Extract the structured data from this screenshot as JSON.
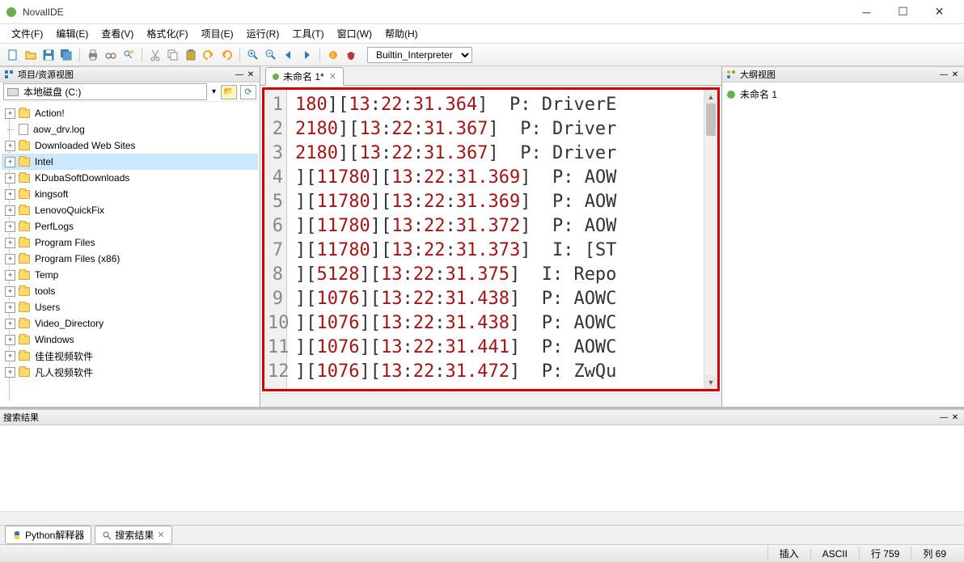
{
  "window": {
    "title": "NovalIDE"
  },
  "menu": {
    "file": "文件(F)",
    "edit": "编辑(E)",
    "view": "查看(V)",
    "format": "格式化(F)",
    "project": "项目(E)",
    "run": "运行(R)",
    "tools": "工具(T)",
    "window": "窗口(W)",
    "help": "帮助(H)"
  },
  "toolbar": {
    "interpreter": "Builtin_Interpreter"
  },
  "project_panel": {
    "title": "项目/资源视图",
    "path_label": "本地磁盘 (C:)",
    "items": [
      {
        "name": "Action!",
        "type": "folder",
        "expandable": true
      },
      {
        "name": "aow_drv.log",
        "type": "file",
        "expandable": false
      },
      {
        "name": "Downloaded Web Sites",
        "type": "folder",
        "expandable": true
      },
      {
        "name": "Intel",
        "type": "folder",
        "expandable": true,
        "selected": true
      },
      {
        "name": "KDubaSoftDownloads",
        "type": "folder",
        "expandable": true
      },
      {
        "name": "kingsoft",
        "type": "folder",
        "expandable": true
      },
      {
        "name": "LenovoQuickFix",
        "type": "folder",
        "expandable": true
      },
      {
        "name": "PerfLogs",
        "type": "folder",
        "expandable": true
      },
      {
        "name": "Program Files",
        "type": "folder",
        "expandable": true
      },
      {
        "name": "Program Files (x86)",
        "type": "folder",
        "expandable": true
      },
      {
        "name": "Temp",
        "type": "folder",
        "expandable": true
      },
      {
        "name": "tools",
        "type": "folder",
        "expandable": true
      },
      {
        "name": "Users",
        "type": "folder",
        "expandable": true
      },
      {
        "name": "Video_Directory",
        "type": "folder",
        "expandable": true
      },
      {
        "name": "Windows",
        "type": "folder",
        "expandable": true
      },
      {
        "name": "佳佳视频软件",
        "type": "folder",
        "expandable": true
      },
      {
        "name": "凡人视频软件",
        "type": "folder",
        "expandable": true
      }
    ]
  },
  "editor": {
    "tab_title": "未命名 1*",
    "lines": [
      {
        "n": "1",
        "segs": [
          {
            "t": "num",
            "v": "180"
          },
          {
            "t": "br",
            "v": "]["
          },
          {
            "t": "num",
            "v": "13"
          },
          {
            "t": "br",
            "v": ":"
          },
          {
            "t": "num",
            "v": "22"
          },
          {
            "t": "br",
            "v": ":"
          },
          {
            "t": "num",
            "v": "31.364"
          },
          {
            "t": "br",
            "v": "]"
          },
          {
            "t": "txt",
            "v": "  P: DriverE"
          }
        ]
      },
      {
        "n": "2",
        "segs": [
          {
            "t": "num",
            "v": "2180"
          },
          {
            "t": "br",
            "v": "]["
          },
          {
            "t": "num",
            "v": "13"
          },
          {
            "t": "br",
            "v": ":"
          },
          {
            "t": "num",
            "v": "22"
          },
          {
            "t": "br",
            "v": ":"
          },
          {
            "t": "num",
            "v": "31.367"
          },
          {
            "t": "br",
            "v": "]"
          },
          {
            "t": "txt",
            "v": "  P: Driver"
          }
        ]
      },
      {
        "n": "3",
        "segs": [
          {
            "t": "num",
            "v": "2180"
          },
          {
            "t": "br",
            "v": "]["
          },
          {
            "t": "num",
            "v": "13"
          },
          {
            "t": "br",
            "v": ":"
          },
          {
            "t": "num",
            "v": "22"
          },
          {
            "t": "br",
            "v": ":"
          },
          {
            "t": "num",
            "v": "31.367"
          },
          {
            "t": "br",
            "v": "]"
          },
          {
            "t": "txt",
            "v": "  P: Driver"
          }
        ]
      },
      {
        "n": "4",
        "segs": [
          {
            "t": "br",
            "v": "]["
          },
          {
            "t": "num",
            "v": "11780"
          },
          {
            "t": "br",
            "v": "]["
          },
          {
            "t": "num",
            "v": "13"
          },
          {
            "t": "br",
            "v": ":"
          },
          {
            "t": "num",
            "v": "22"
          },
          {
            "t": "br",
            "v": ":"
          },
          {
            "t": "num",
            "v": "31.369"
          },
          {
            "t": "br",
            "v": "]"
          },
          {
            "t": "txt",
            "v": "  P: AOW"
          }
        ]
      },
      {
        "n": "5",
        "segs": [
          {
            "t": "br",
            "v": "]["
          },
          {
            "t": "num",
            "v": "11780"
          },
          {
            "t": "br",
            "v": "]["
          },
          {
            "t": "num",
            "v": "13"
          },
          {
            "t": "br",
            "v": ":"
          },
          {
            "t": "num",
            "v": "22"
          },
          {
            "t": "br",
            "v": ":"
          },
          {
            "t": "num",
            "v": "31.369"
          },
          {
            "t": "br",
            "v": "]"
          },
          {
            "t": "txt",
            "v": "  P: AOW"
          }
        ]
      },
      {
        "n": "6",
        "segs": [
          {
            "t": "br",
            "v": "]["
          },
          {
            "t": "num",
            "v": "11780"
          },
          {
            "t": "br",
            "v": "]["
          },
          {
            "t": "num",
            "v": "13"
          },
          {
            "t": "br",
            "v": ":"
          },
          {
            "t": "num",
            "v": "22"
          },
          {
            "t": "br",
            "v": ":"
          },
          {
            "t": "num",
            "v": "31.372"
          },
          {
            "t": "br",
            "v": "]"
          },
          {
            "t": "txt",
            "v": "  P: AOW"
          }
        ]
      },
      {
        "n": "7",
        "segs": [
          {
            "t": "br",
            "v": "]["
          },
          {
            "t": "num",
            "v": "11780"
          },
          {
            "t": "br",
            "v": "]["
          },
          {
            "t": "num",
            "v": "13"
          },
          {
            "t": "br",
            "v": ":"
          },
          {
            "t": "num",
            "v": "22"
          },
          {
            "t": "br",
            "v": ":"
          },
          {
            "t": "num",
            "v": "31.373"
          },
          {
            "t": "br",
            "v": "]"
          },
          {
            "t": "txt",
            "v": "  I: [ST"
          }
        ]
      },
      {
        "n": "8",
        "segs": [
          {
            "t": "br",
            "v": "]["
          },
          {
            "t": "num",
            "v": "5128"
          },
          {
            "t": "br",
            "v": "]["
          },
          {
            "t": "num",
            "v": "13"
          },
          {
            "t": "br",
            "v": ":"
          },
          {
            "t": "num",
            "v": "22"
          },
          {
            "t": "br",
            "v": ":"
          },
          {
            "t": "num",
            "v": "31.375"
          },
          {
            "t": "br",
            "v": "]"
          },
          {
            "t": "txt",
            "v": "  I: Repo"
          }
        ]
      },
      {
        "n": "9",
        "segs": [
          {
            "t": "br",
            "v": "]["
          },
          {
            "t": "num",
            "v": "1076"
          },
          {
            "t": "br",
            "v": "]["
          },
          {
            "t": "num",
            "v": "13"
          },
          {
            "t": "br",
            "v": ":"
          },
          {
            "t": "num",
            "v": "22"
          },
          {
            "t": "br",
            "v": ":"
          },
          {
            "t": "num",
            "v": "31.438"
          },
          {
            "t": "br",
            "v": "]"
          },
          {
            "t": "txt",
            "v": "  P: AOWC"
          }
        ]
      },
      {
        "n": "10",
        "segs": [
          {
            "t": "br",
            "v": "]["
          },
          {
            "t": "num",
            "v": "1076"
          },
          {
            "t": "br",
            "v": "]["
          },
          {
            "t": "num",
            "v": "13"
          },
          {
            "t": "br",
            "v": ":"
          },
          {
            "t": "num",
            "v": "22"
          },
          {
            "t": "br",
            "v": ":"
          },
          {
            "t": "num",
            "v": "31.438"
          },
          {
            "t": "br",
            "v": "]"
          },
          {
            "t": "txt",
            "v": "  P: AOWC"
          }
        ]
      },
      {
        "n": "11",
        "segs": [
          {
            "t": "br",
            "v": "]["
          },
          {
            "t": "num",
            "v": "1076"
          },
          {
            "t": "br",
            "v": "]["
          },
          {
            "t": "num",
            "v": "13"
          },
          {
            "t": "br",
            "v": ":"
          },
          {
            "t": "num",
            "v": "22"
          },
          {
            "t": "br",
            "v": ":"
          },
          {
            "t": "num",
            "v": "31.441"
          },
          {
            "t": "br",
            "v": "]"
          },
          {
            "t": "txt",
            "v": "  P: AOWC"
          }
        ]
      },
      {
        "n": "12",
        "segs": [
          {
            "t": "br",
            "v": "]["
          },
          {
            "t": "num",
            "v": "1076"
          },
          {
            "t": "br",
            "v": "]["
          },
          {
            "t": "num",
            "v": "13"
          },
          {
            "t": "br",
            "v": ":"
          },
          {
            "t": "num",
            "v": "22"
          },
          {
            "t": "br",
            "v": ":"
          },
          {
            "t": "num",
            "v": "31.472"
          },
          {
            "t": "br",
            "v": "]"
          },
          {
            "t": "txt",
            "v": "  P: ZwQu"
          }
        ]
      }
    ]
  },
  "outline": {
    "title": "大纲视图",
    "item": "未命名 1"
  },
  "search": {
    "title": "搜索结果"
  },
  "bottom_tabs": {
    "python": "Python解释器",
    "search": "搜索结果"
  },
  "status": {
    "mode": "插入",
    "encoding": "ASCII",
    "line": "行 759",
    "col": "列 69"
  }
}
